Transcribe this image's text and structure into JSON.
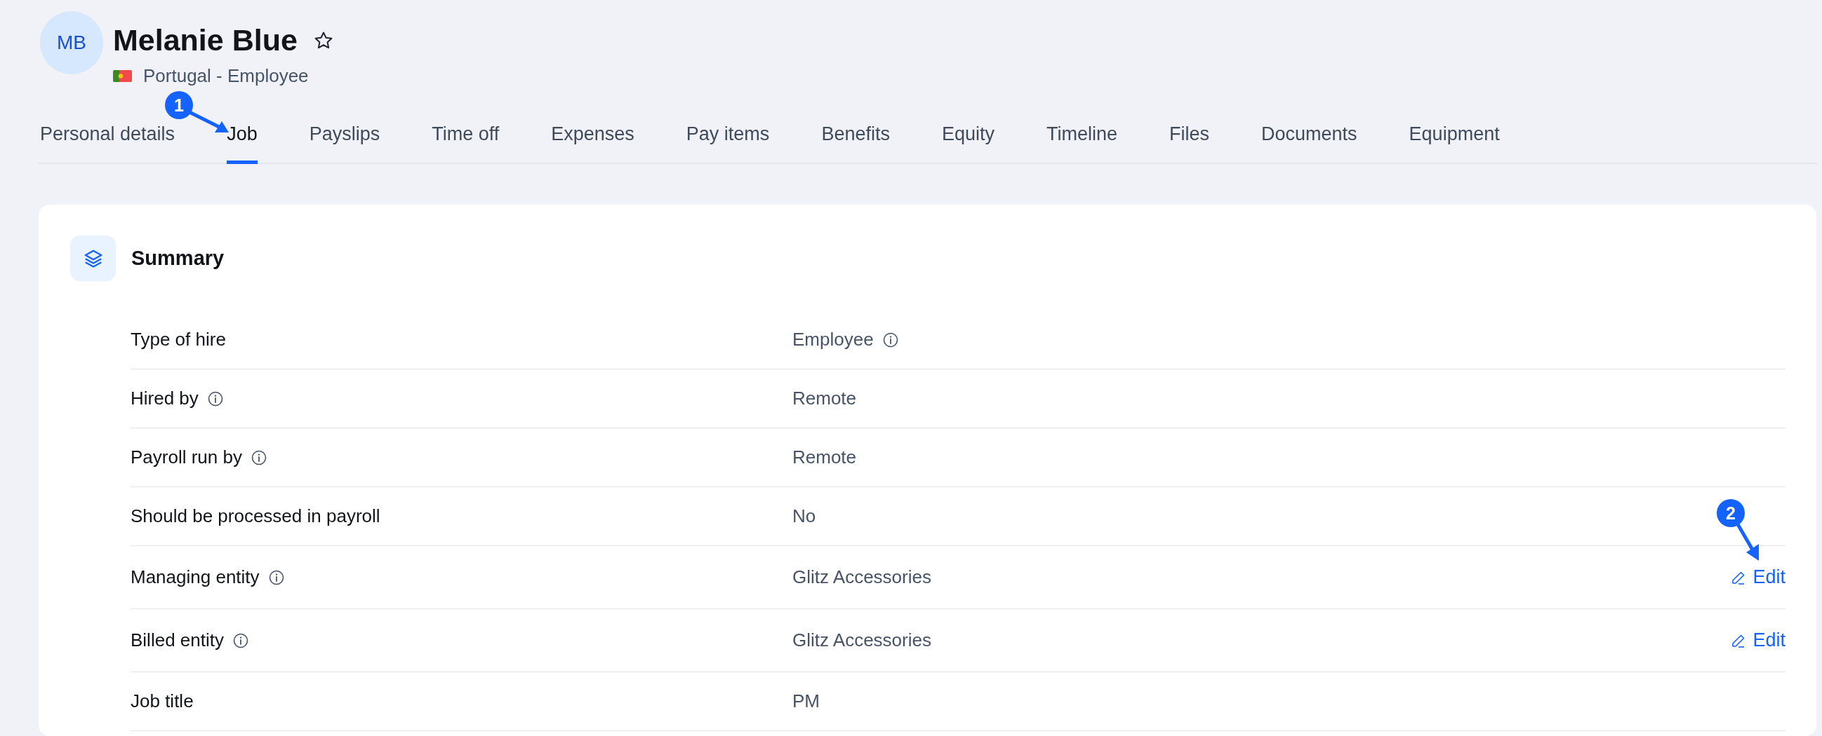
{
  "header": {
    "initials": "MB",
    "name": "Melanie Blue",
    "subtitle": "Portugal - Employee"
  },
  "tabs": [
    {
      "label": "Personal details",
      "selected": false
    },
    {
      "label": "Job",
      "selected": true
    },
    {
      "label": "Payslips",
      "selected": false
    },
    {
      "label": "Time off",
      "selected": false
    },
    {
      "label": "Expenses",
      "selected": false
    },
    {
      "label": "Pay items",
      "selected": false
    },
    {
      "label": "Benefits",
      "selected": false
    },
    {
      "label": "Equity",
      "selected": false
    },
    {
      "label": "Timeline",
      "selected": false
    },
    {
      "label": "Files",
      "selected": false
    },
    {
      "label": "Documents",
      "selected": false
    },
    {
      "label": "Equipment",
      "selected": false
    }
  ],
  "summary": {
    "title": "Summary",
    "rows": [
      {
        "label": "Type of hire",
        "label_info": false,
        "value": "Employee",
        "value_info": true
      },
      {
        "label": "Hired by",
        "label_info": true,
        "value": "Remote",
        "value_info": false
      },
      {
        "label": "Payroll run by",
        "label_info": true,
        "value": "Remote",
        "value_info": false
      },
      {
        "label": "Should be processed in payroll",
        "label_info": false,
        "value": "No",
        "value_info": false
      },
      {
        "label": "Managing entity",
        "label_info": true,
        "value": "Glitz Accessories",
        "value_info": false,
        "action": "Edit"
      },
      {
        "label": "Billed entity",
        "label_info": true,
        "value": "Glitz Accessories",
        "value_info": false,
        "action": "Edit"
      },
      {
        "label": "Job title",
        "label_info": false,
        "value": "PM",
        "value_info": false
      }
    ]
  },
  "annotations": [
    {
      "number": "1"
    },
    {
      "number": "2"
    }
  ]
}
